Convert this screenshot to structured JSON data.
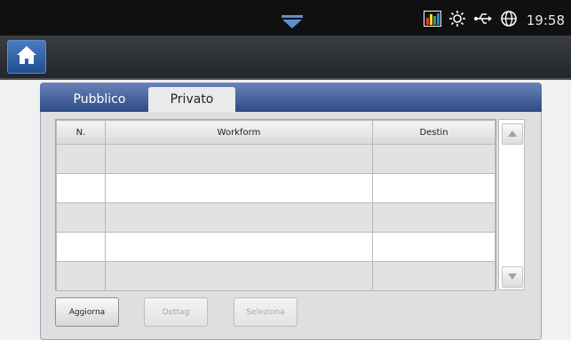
{
  "status_bar": {
    "time": "19:58",
    "icons": [
      "notification-pull-icon",
      "bar-graph-icon",
      "sun-icon",
      "usb-icon",
      "globe-icon"
    ]
  },
  "tabs": [
    {
      "label": "Pubblico",
      "active": false
    },
    {
      "label": "Privato",
      "active": true
    }
  ],
  "table": {
    "headers": [
      "N.",
      "Workform",
      "Destin"
    ],
    "rows": [
      [
        "",
        "",
        ""
      ],
      [
        "",
        "",
        ""
      ],
      [
        "",
        "",
        ""
      ],
      [
        "",
        "",
        ""
      ],
      [
        "",
        "",
        ""
      ]
    ]
  },
  "buttons": {
    "refresh": "Aggiorna",
    "details": "Dettag",
    "select": "Seleziona"
  },
  "colors": {
    "tab_bar": "#3a5898",
    "home_button": "#2c5fa6",
    "status_bar": "#101010"
  }
}
